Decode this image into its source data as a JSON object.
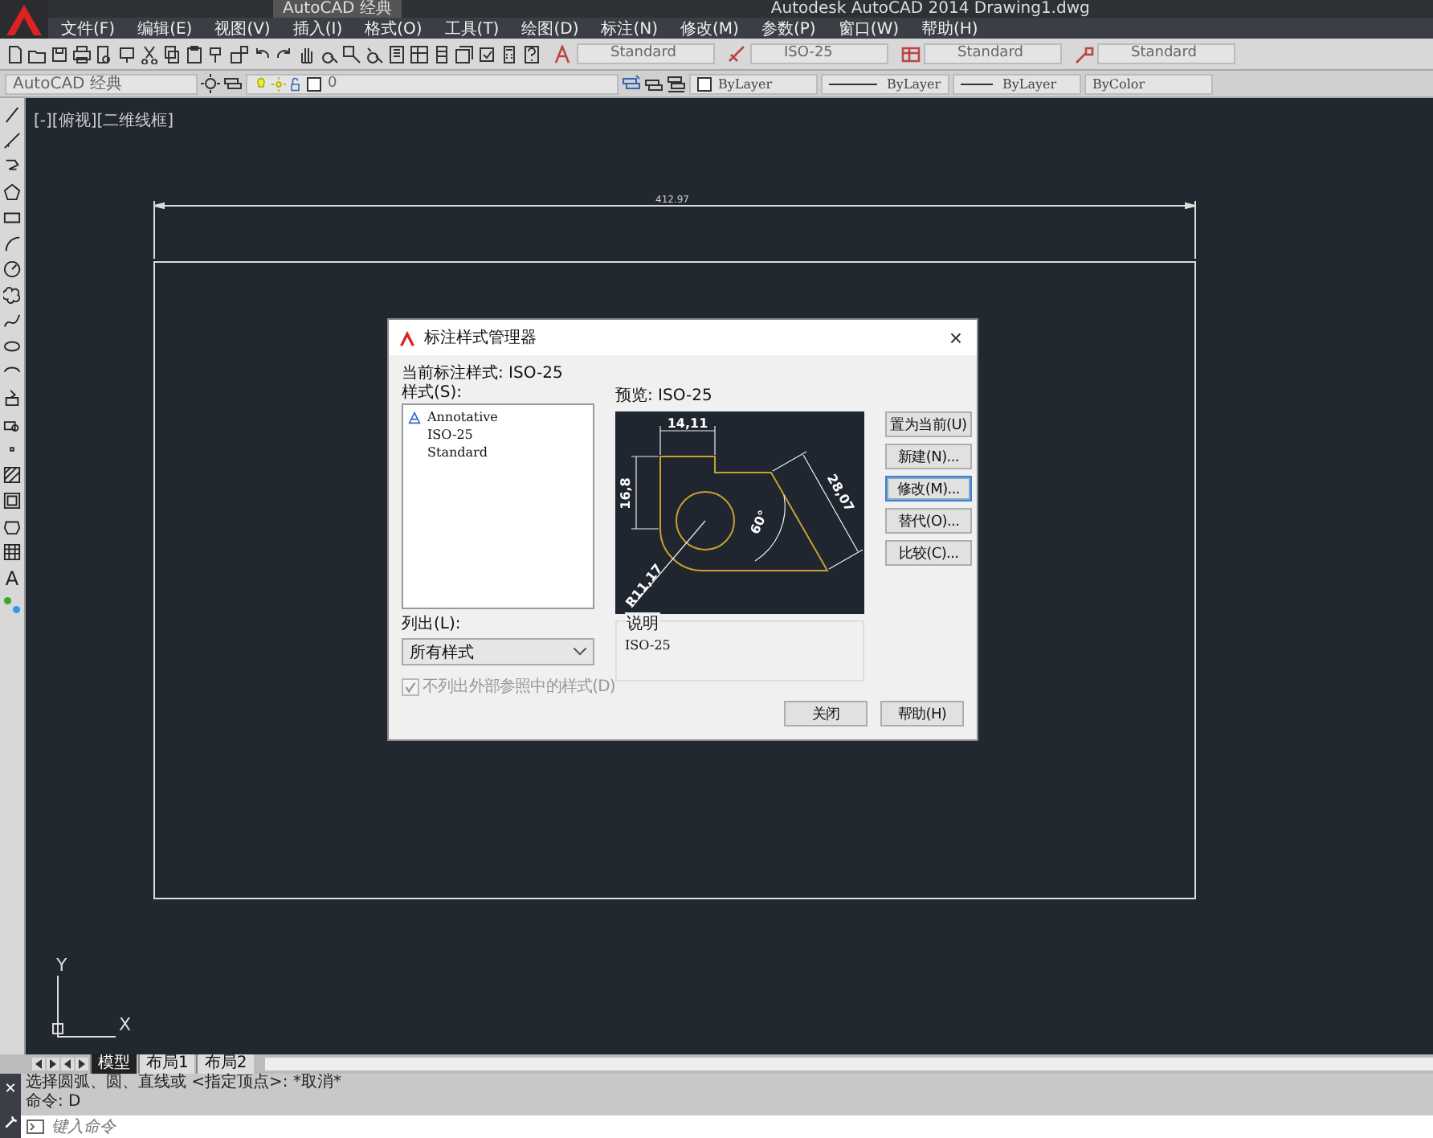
{
  "title_bar": {
    "workspace": "AutoCAD 经典",
    "title": "Autodesk AutoCAD 2014    Drawing1.dwg"
  },
  "menu": [
    "文件(F)",
    "编辑(E)",
    "视图(V)",
    "插入(I)",
    "格式(O)",
    "工具(T)",
    "绘图(D)",
    "标注(N)",
    "修改(M)",
    "参数(P)",
    "窗口(W)",
    "帮助(H)"
  ],
  "style_combos": [
    {
      "value": "Standard"
    },
    {
      "value": "ISO-25"
    },
    {
      "value": "Standard"
    },
    {
      "value": "Standard"
    }
  ],
  "workspace_combo": {
    "value": "AutoCAD 经典"
  },
  "layer_combo": {
    "value": "0"
  },
  "property_combos": [
    {
      "kind": "color",
      "value": "ByLayer"
    },
    {
      "kind": "linetype",
      "value": "ByLayer"
    },
    {
      "kind": "lineweight",
      "value": "ByLayer"
    },
    {
      "kind": "plotstyle",
      "value": "ByColor"
    }
  ],
  "text_tool_glyph": "A",
  "viewport_label": "[-][俯视][二维线框]",
  "drawing": {
    "dimension": "412.97"
  },
  "ucs": {
    "x_label": "X",
    "y_label": "Y"
  },
  "dialog": {
    "title": "标注样式管理器",
    "close": "×",
    "current_style": "当前标注样式: ISO-25",
    "styles_label": "样式(S):",
    "styles": [
      {
        "name": "Annotative",
        "annotative": true
      },
      {
        "name": "ISO-25",
        "annotative": false
      },
      {
        "name": "Standard",
        "annotative": false
      }
    ],
    "preview_label": "预览: ISO-25",
    "preview_dims": [
      "14,11",
      "16,8",
      "28,07",
      "60°",
      "R11,17"
    ],
    "list_label": "列出(L):",
    "list_value": "所有样式",
    "checkbox": {
      "label": "不列出外部参照中的样式(D)",
      "checked": true,
      "disabled": true
    },
    "description_label": "说明",
    "description": "ISO-25",
    "side_buttons": [
      {
        "label": "置为当前(U)",
        "focused": false
      },
      {
        "label": "新建(N)...",
        "focused": false
      },
      {
        "label": "修改(M)...",
        "focused": true
      },
      {
        "label": "替代(O)...",
        "focused": false
      },
      {
        "label": "比较(C)...",
        "focused": false
      }
    ],
    "bottom_buttons": [
      "关闭",
      "帮助(H)"
    ]
  },
  "layout_tabs": [
    {
      "label": "模型",
      "selected": true
    },
    {
      "label": "布局1",
      "selected": false
    },
    {
      "label": "布局2",
      "selected": false
    }
  ],
  "command_close": "✕",
  "command_history": [
    "选择圆弧、圆、直线或 <指定顶点>: *取消*",
    "命令: D"
  ],
  "command_input": {
    "placeholder": "键入命令"
  }
}
